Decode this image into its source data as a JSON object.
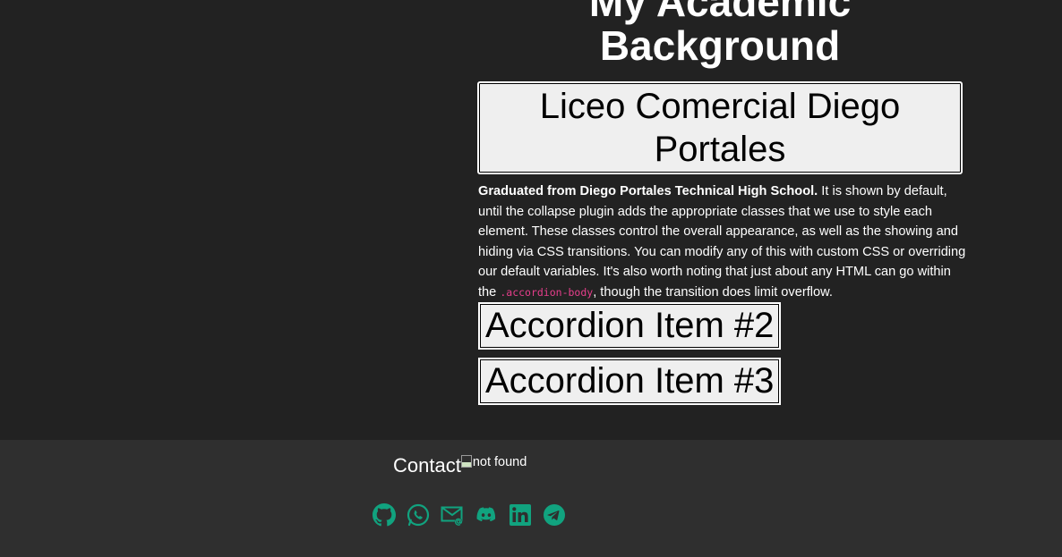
{
  "section": {
    "title": "My Academic Background"
  },
  "accordion": {
    "item1": {
      "header": "Liceo Comercial Diego Portales",
      "body_strong": "Graduated from Diego Portales Technical High School.",
      "body_text": " It is shown by default, until the collapse plugin adds the appropriate classes that we use to style each element. These classes control the overall appearance, as well as the showing and hiding via CSS transitions. You can modify any of this with custom CSS or overriding our default variables. It's also worth noting that just about any HTML can go within the ",
      "body_code": ".accordion-body",
      "body_tail": ", though the transition does limit overflow."
    },
    "item2": {
      "header": "Accordion Item #2"
    },
    "item3": {
      "header": "Accordion Item #3"
    }
  },
  "footer": {
    "contact_title": "Contact",
    "contact_image_alt": "not found",
    "social_icons": [
      "github-icon",
      "whatsapp-icon",
      "email-icon",
      "discord-icon",
      "linkedin-icon",
      "telegram-icon"
    ],
    "icon_color": "#11a37f"
  },
  "colors": {
    "background": "#222222",
    "footer_background": "#2f2f2f",
    "code": "#e83e8c"
  }
}
